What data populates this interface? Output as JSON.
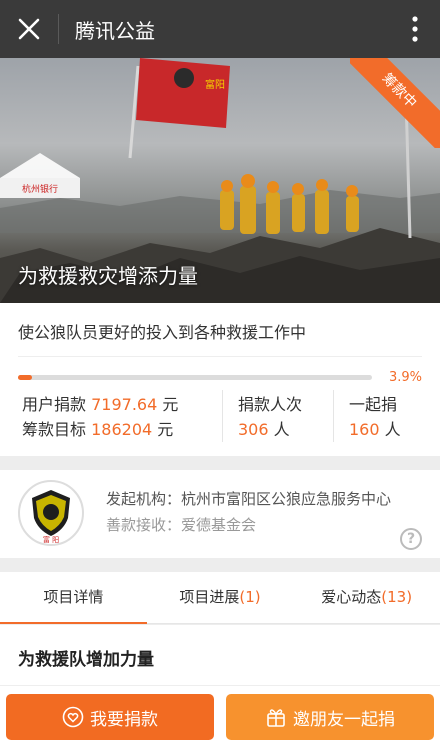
{
  "topbar": {
    "title": "腾讯公益"
  },
  "hero": {
    "title": "为救援救灾增添力量",
    "ribbon": "筹款中",
    "flag_text": "富阳",
    "tent_text": "杭州银行"
  },
  "project": {
    "desc": "使公狼队员更好的投入到各种救援工作中",
    "progress_percent": 3.9,
    "progress_label": "3.9%",
    "raised_label": "用户捐款",
    "raised_value": "7197.64",
    "raised_unit": "元",
    "target_label": "筹款目标",
    "target_value": "186204",
    "target_unit": "元",
    "donors_label": "捐款人次",
    "donors_value": "306",
    "donors_unit": "人",
    "together_label": "一起捐",
    "together_value": "160",
    "together_unit": "人"
  },
  "org": {
    "initiator": "发起机构：杭州市富阳区公狼应急服务中心",
    "receiver": "善款接收：爱德基金会",
    "logo_text": "富 阳",
    "help": "?"
  },
  "tabs": [
    {
      "label": "项目详情",
      "count": ""
    },
    {
      "label": "项目进展",
      "count": "(1)"
    },
    {
      "label": "爱心动态",
      "count": "(13)"
    }
  ],
  "detail": {
    "title": "为救援队增加力量"
  },
  "buttons": {
    "donate": "我要捐款",
    "invite": "邀朋友一起捐"
  },
  "colors": {
    "accent": "#f26c2a",
    "topbar": "#3a3a3a"
  }
}
